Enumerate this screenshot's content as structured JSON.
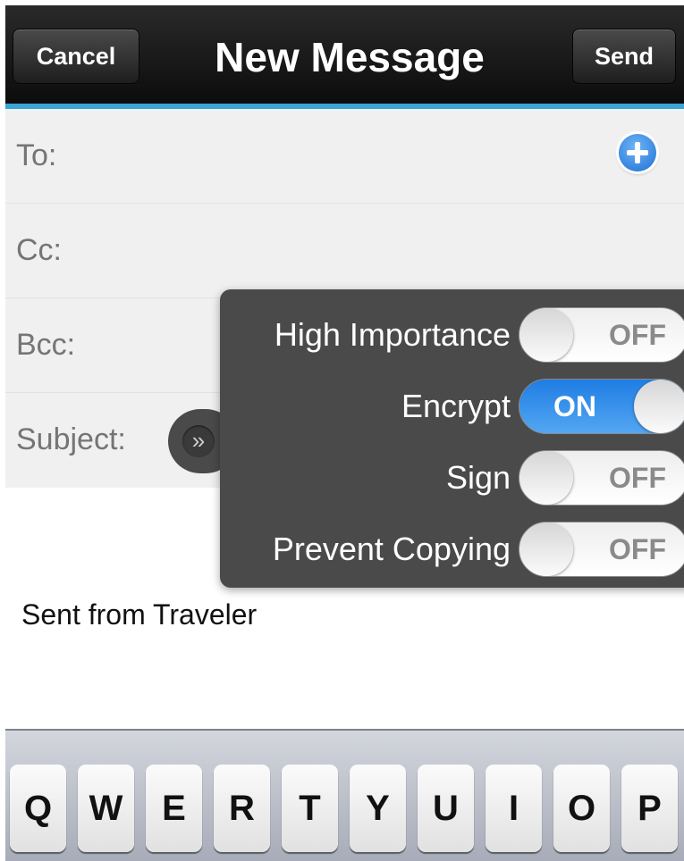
{
  "nav": {
    "cancel_label": "Cancel",
    "title": "New Message",
    "send_label": "Send"
  },
  "fields": {
    "to_label": "To:",
    "cc_label": "Cc:",
    "bcc_label": "Bcc:",
    "subject_label": "Subject:"
  },
  "options": {
    "expand_glyph": "»",
    "items": [
      {
        "label": "High Importance",
        "state": "OFF"
      },
      {
        "label": "Encrypt",
        "state": "ON"
      },
      {
        "label": "Sign",
        "state": "OFF"
      },
      {
        "label": "Prevent Copying",
        "state": "OFF"
      }
    ]
  },
  "body": {
    "signature": "Sent from Traveler"
  },
  "keyboard": {
    "keys": [
      "Q",
      "W",
      "E",
      "R",
      "T",
      "Y",
      "U",
      "I",
      "O",
      "P"
    ]
  },
  "colors": {
    "nav_accent": "#3aa4d4",
    "switch_on": "#2f8ce8",
    "popover_bg": "#4a4a4a",
    "add_button": "#2f7fe0"
  }
}
